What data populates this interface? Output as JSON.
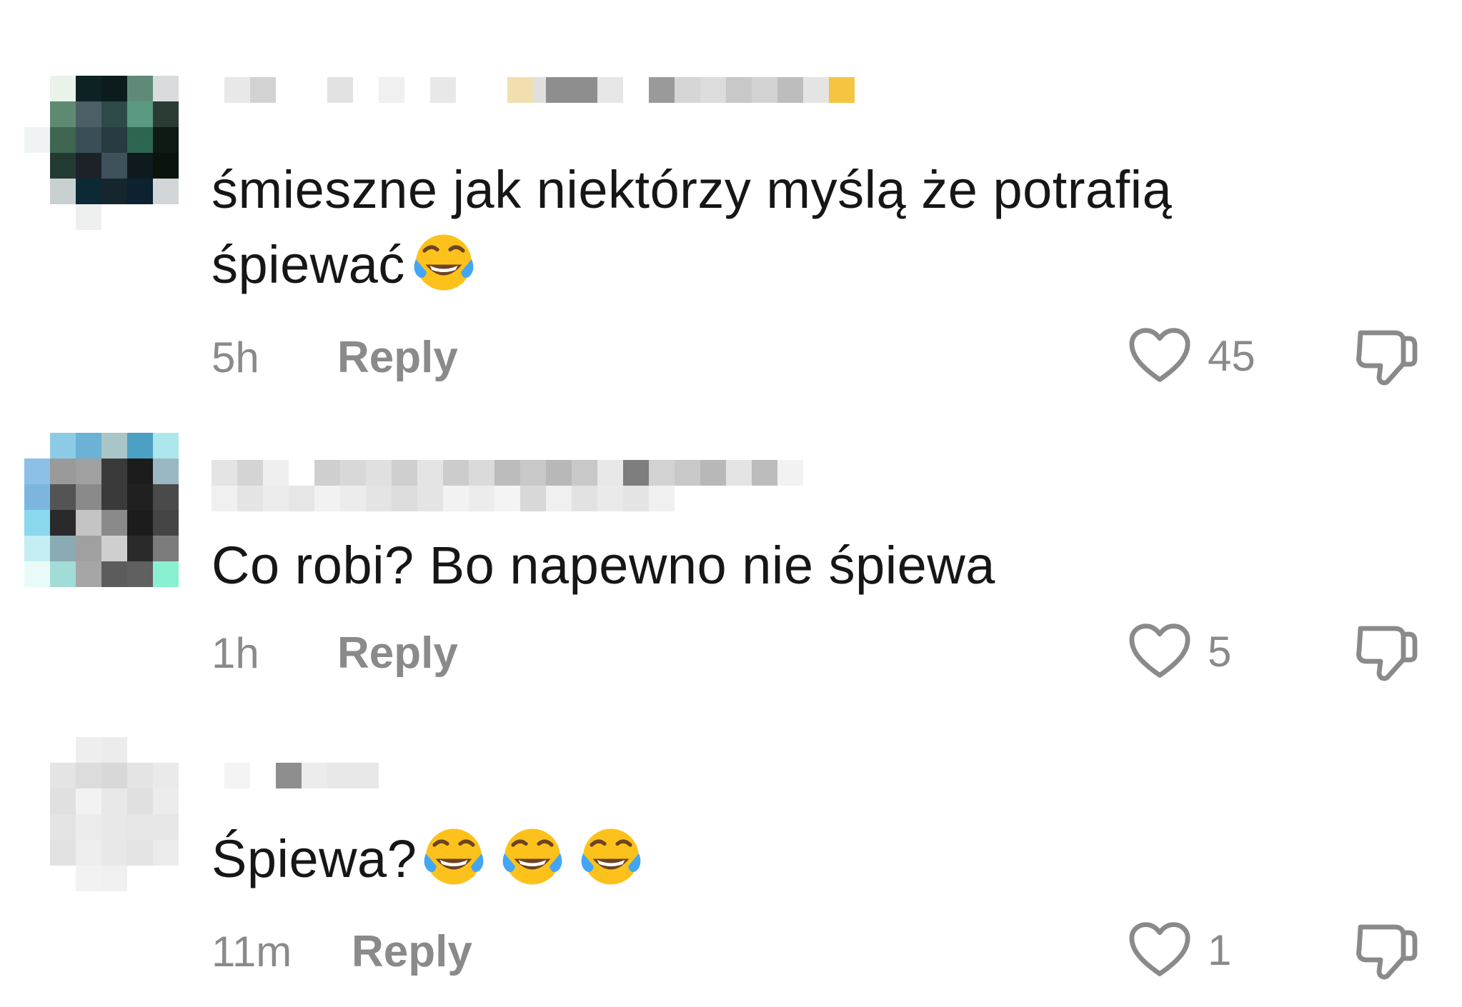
{
  "comments": [
    {
      "text": "śmieszne jak niektórzy myślą że potrafią śpiewać",
      "emoji_count": 1,
      "time": "5h",
      "reply_label": "Reply",
      "likes": "45"
    },
    {
      "text": "Co robi? Bo napewno nie śpiewa",
      "emoji_count": 0,
      "time": "1h",
      "reply_label": "Reply",
      "likes": "5"
    },
    {
      "text": "Śpiewa?",
      "emoji_count": 3,
      "time": "11m",
      "reply_label": "Reply",
      "likes": "1"
    }
  ],
  "icons": {
    "like": "heart-outline-icon",
    "dislike": "thumbs-down-outline-icon",
    "emoji": "face-with-tears-of-joy-emoji"
  },
  "colors": {
    "text": "#161616",
    "muted": "#8a8a8a",
    "emoji_face": "#fcc21b"
  }
}
